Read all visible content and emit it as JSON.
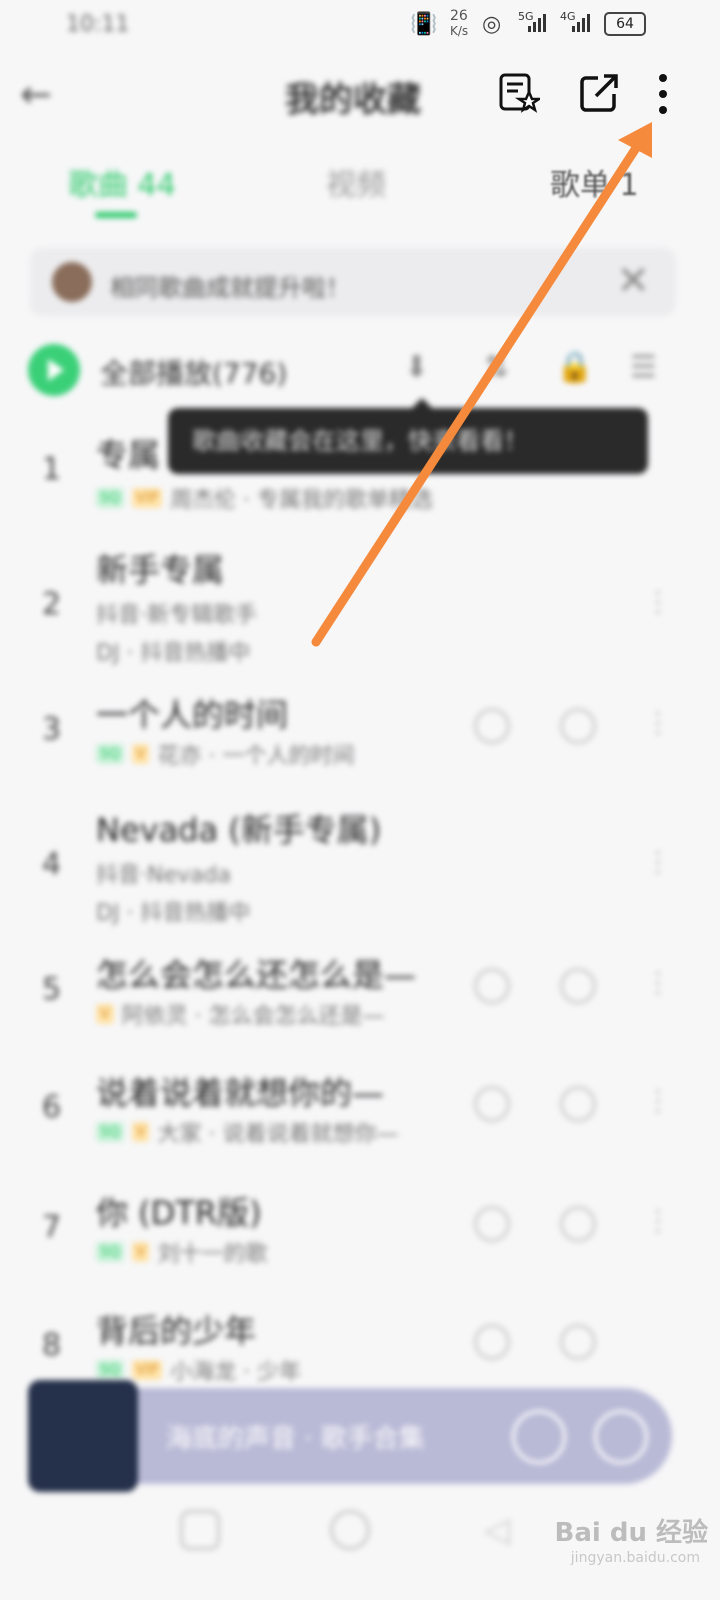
{
  "status_bar": {
    "time": "10:11",
    "net_speed": "26",
    "net_unit": "K/s",
    "sig1": "5G",
    "sig2": "4G",
    "battery": "64"
  },
  "header": {
    "title": "我的收藏"
  },
  "tabs": [
    {
      "label": "歌曲 44"
    },
    {
      "label": "视频"
    },
    {
      "label": "歌单 1"
    }
  ],
  "banner": {
    "text": "相同歌曲成就提升啦！"
  },
  "toolbar": {
    "play_all": "全部播放(776)"
  },
  "tooltip": {
    "text": "歌曲收藏会在这里，快来看看！"
  },
  "songs": [
    {
      "num": "1",
      "name": "专属",
      "sub": "周杰伦 · 专属我的歌单精选"
    },
    {
      "num": "2",
      "name": "新手专属",
      "sub": "抖音·新专辑歌手",
      "sub2": "DJ · 抖音热播中"
    },
    {
      "num": "3",
      "name": "一个人的时间",
      "sub": "花亦 · 一个人的时间"
    },
    {
      "num": "4",
      "name": "Nevada (新手专属)",
      "sub": "抖音·Nevada",
      "sub2": "DJ · 抖音热播中"
    },
    {
      "num": "5",
      "name": "怎么会怎么还怎么是—",
      "sub": "阿依灵 · 怎么会怎么还是—"
    },
    {
      "num": "6",
      "name": "说着说着就想你的—",
      "sub": "大家 · 说着说着就想你—"
    },
    {
      "num": "7",
      "name": "你 (DTR版)",
      "sub": "刘十一的歌"
    },
    {
      "num": "8",
      "name": "背后的少年",
      "sub": "小海龙 · 少年"
    }
  ],
  "player": {
    "text": "海底的声音 · 歌手合集"
  },
  "watermark": {
    "brand": "Bai du 经验",
    "url": "jingyan.baidu.com"
  }
}
